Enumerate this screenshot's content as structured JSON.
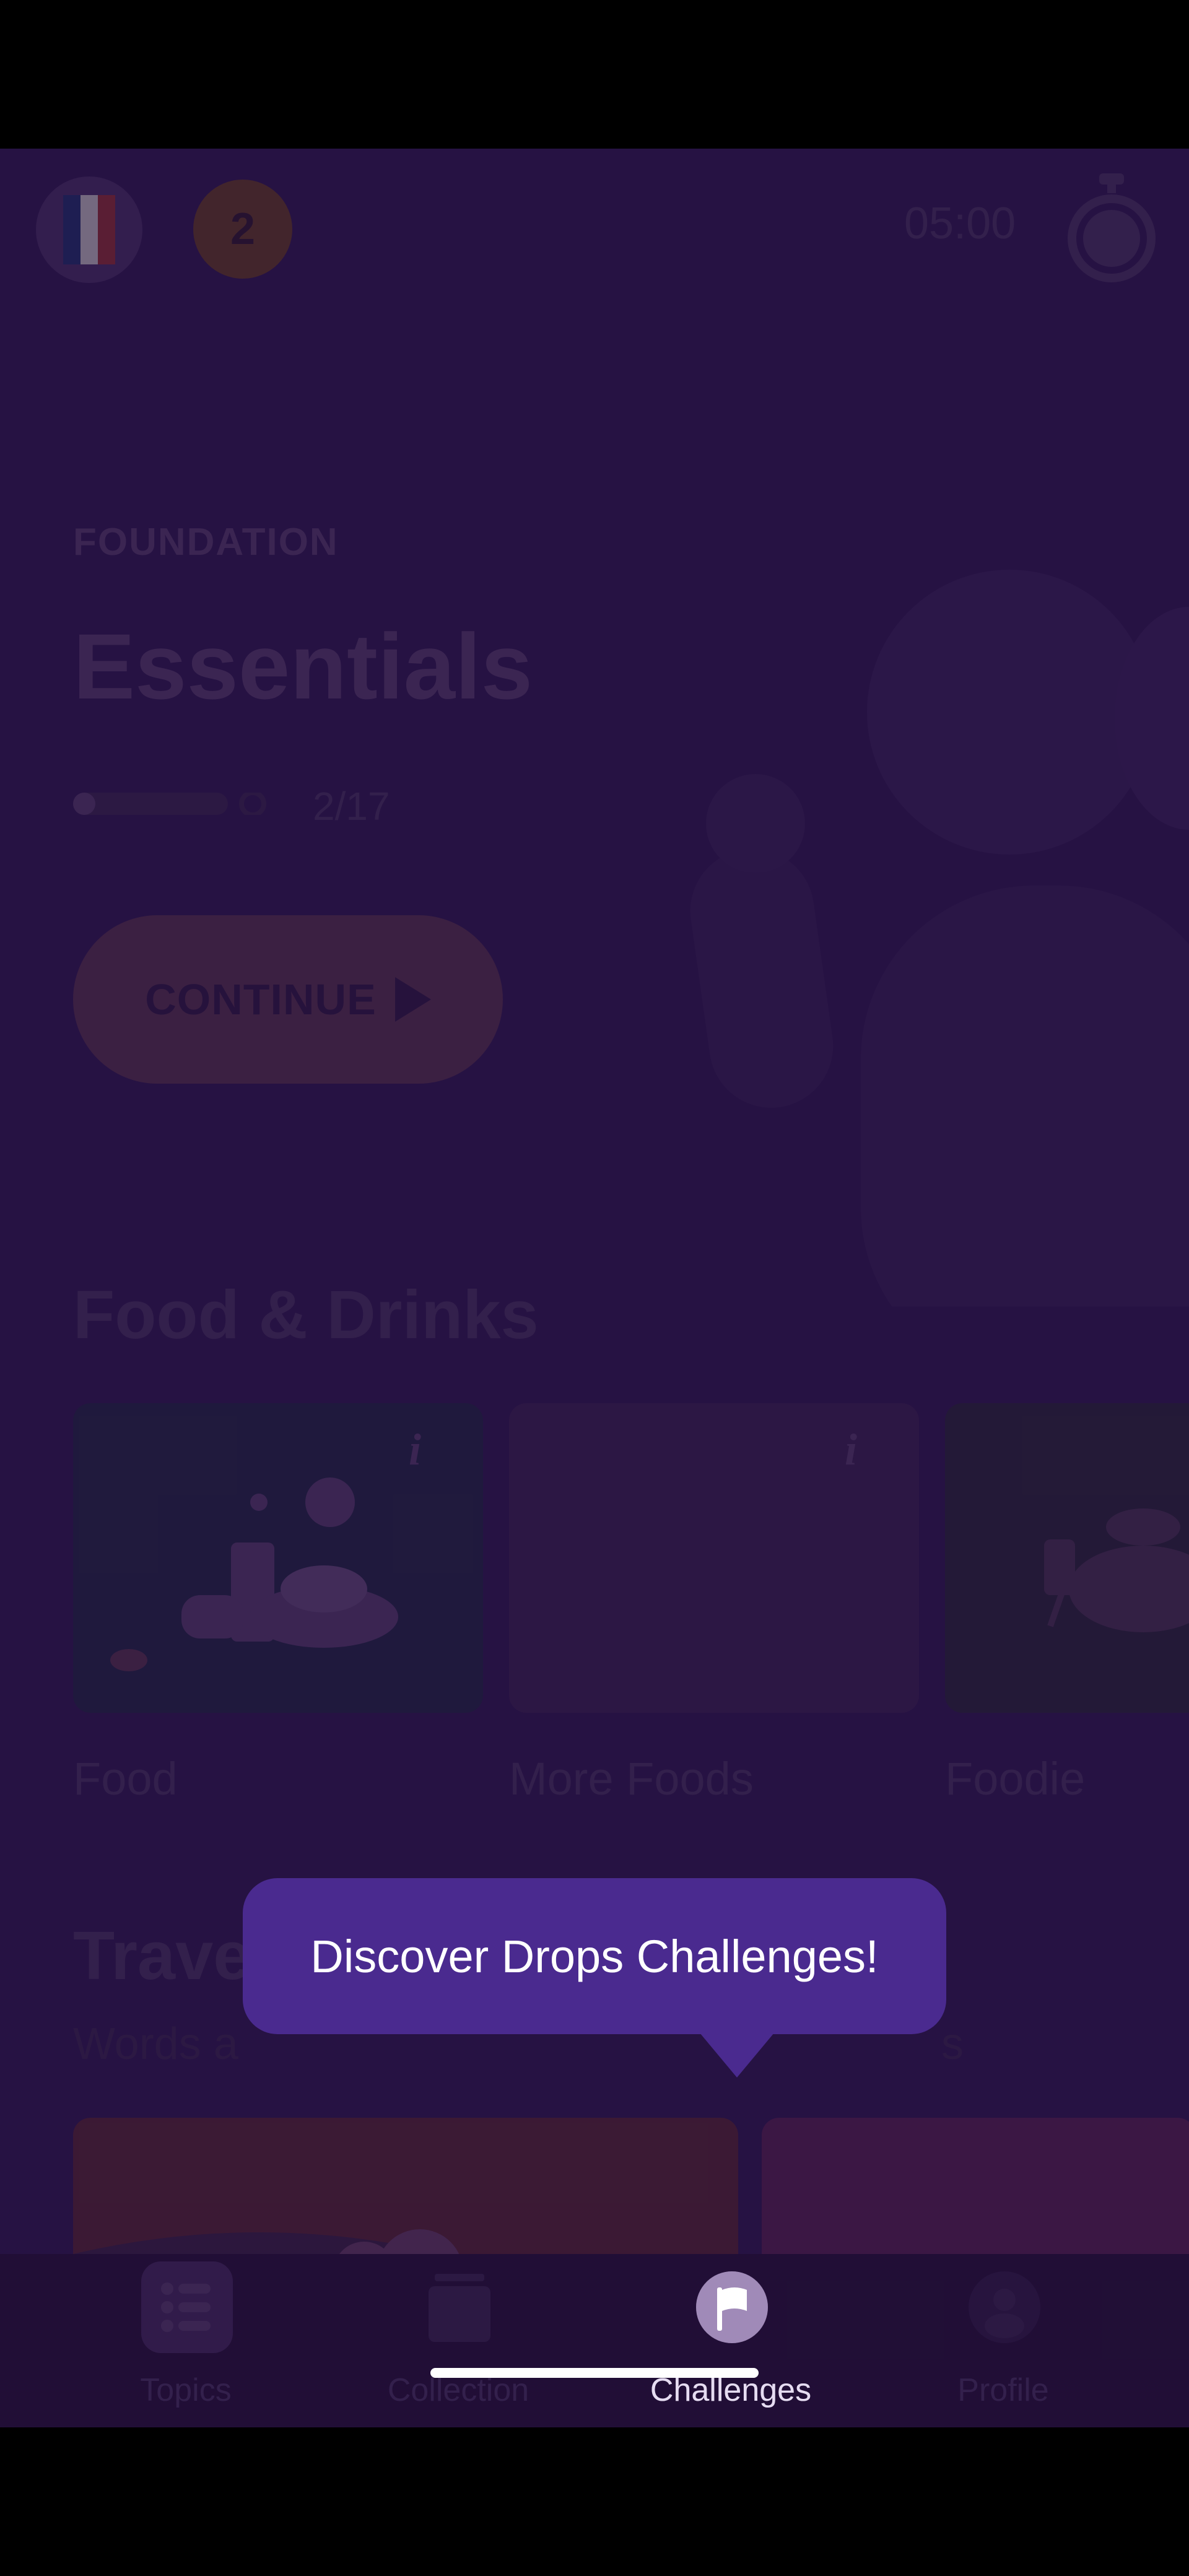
{
  "header": {
    "streak_count": "2",
    "timer": "05:00"
  },
  "hero": {
    "eyebrow": "FOUNDATION",
    "title": "Essentials",
    "progress_text": "2/17",
    "progress_fraction": 0.118,
    "continue_label": "CONTINUE"
  },
  "sections": [
    {
      "title": "Food & Drinks",
      "cards": [
        {
          "label": "Food",
          "color": "#2e2f5e"
        },
        {
          "label": "More Foods",
          "color": "#4a2a6e"
        },
        {
          "label": "Foodie",
          "color": "#373050"
        }
      ]
    },
    {
      "title": "Travel Talk",
      "subtitle_left": "Words a",
      "subtitle_right": "s"
    }
  ],
  "tooltip": {
    "text": "Discover Drops Challenges!"
  },
  "tabs": [
    {
      "label": "Topics",
      "icon": "list-icon",
      "active": false
    },
    {
      "label": "Collection",
      "icon": "collection-icon",
      "active": false
    },
    {
      "label": "Challenges",
      "icon": "flag-icon",
      "active": true
    },
    {
      "label": "Profile",
      "icon": "profile-icon",
      "active": false
    }
  ],
  "colors": {
    "background": "#3d1f6b",
    "tooltip": "#4a2a8f",
    "continue_button": "#6a3e68",
    "active_tab_text": "#ffffff"
  }
}
